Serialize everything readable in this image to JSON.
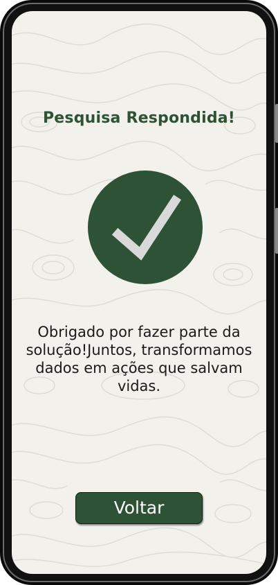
{
  "screen": {
    "title": "Pesquisa Respondida!",
    "message": "Obrigado por fazer parte da solução!Juntos, transformamos dados em ações que salvam vidas.",
    "back_button_label": "Voltar",
    "success_icon": "checkmark-icon"
  },
  "colors": {
    "accent": "#2e5235",
    "background": "#f2f1ec",
    "check_mark": "#d9d9d9"
  }
}
